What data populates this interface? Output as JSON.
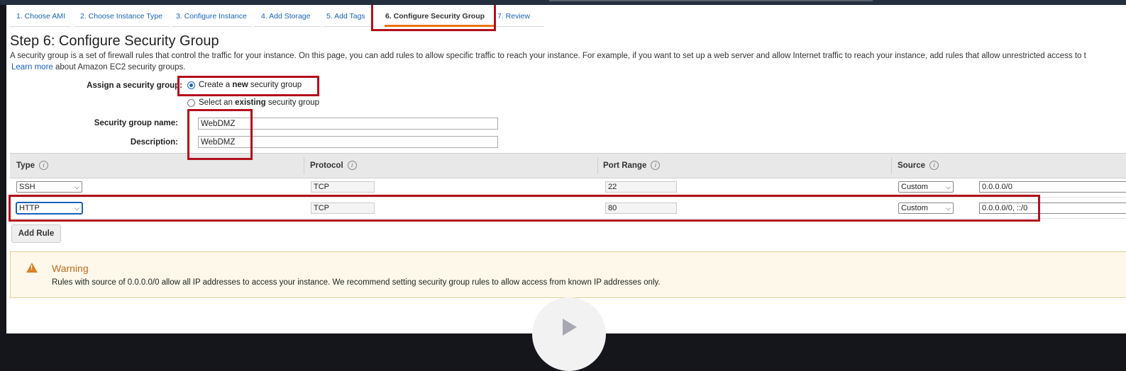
{
  "tabs": [
    {
      "label": "1. Choose AMI"
    },
    {
      "label": "2. Choose Instance Type"
    },
    {
      "label": "3. Configure Instance"
    },
    {
      "label": "4. Add Storage"
    },
    {
      "label": "5. Add Tags"
    },
    {
      "label": "6. Configure Security Group",
      "active": true
    },
    {
      "label": "7. Review"
    }
  ],
  "page": {
    "title": "Step 6: Configure Security Group",
    "intro": "A security group is a set of firewall rules that control the traffic for your instance. On this page, you can add rules to allow specific traffic to reach your instance. For example, if you want to set up a web server and allow Internet traffic to reach your instance, add rules that allow unrestricted access to t",
    "learn_more_link": "Learn more",
    "learn_more_rest": " about Amazon EC2 security groups."
  },
  "assign": {
    "label": "Assign a security group:",
    "option_new_prefix": "Create a ",
    "option_new_bold": "new",
    "option_new_suffix": " security group",
    "option_existing_prefix": "Select an ",
    "option_existing_bold": "existing",
    "option_existing_suffix": " security group",
    "selected": "new"
  },
  "fields": {
    "name_label": "Security group name:",
    "name_value": "WebDMZ",
    "description_label": "Description:",
    "description_value": "WebDMZ"
  },
  "table": {
    "headers": [
      "Type",
      "Protocol",
      "Port Range",
      "Source"
    ],
    "info_icon": "i",
    "rows": [
      {
        "type": "SSH",
        "protocol": "TCP",
        "port": "22",
        "source_mode": "Custom",
        "source": "0.0.0.0/0"
      },
      {
        "type": "HTTP",
        "protocol": "TCP",
        "port": "80",
        "source_mode": "Custom",
        "source": "0.0.0.0/0, ::/0"
      }
    ]
  },
  "add_rule_label": "Add Rule",
  "warning": {
    "icon": "warning-triangle-icon",
    "icon_glyph": "!",
    "title": "Warning",
    "text": "Rules with source of 0.0.0.0/0 allow all IP addresses to access your instance. We recommend setting security group rules to allow access from known IP addresses only."
  },
  "colors": {
    "link": "#1a62b8",
    "highlight": "#b3101b",
    "active_tab_underline": "#ec7211",
    "warning_title": "#c46c1d"
  }
}
